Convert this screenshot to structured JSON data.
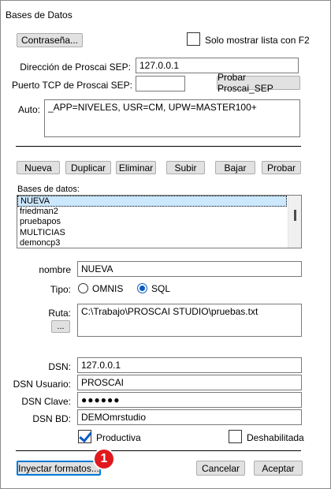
{
  "window": {
    "title": "Bases de Datos"
  },
  "top": {
    "password_button": "Contraseña...",
    "only_list_checkbox": {
      "label": "Solo mostrar lista con F2",
      "checked": false
    }
  },
  "connection": {
    "address_label": "Dirección de Proscai SEP:",
    "address_value": "127.0.0.1",
    "port_label": "Puerto TCP de Proscai SEP:",
    "port_value": "",
    "test_button": "Probar Proscai_SEP",
    "auto_label": "Auto:",
    "auto_value": "_APP=NIVELES, USR=CM, UPW=MASTER100+"
  },
  "actions": {
    "new": "Nueva",
    "duplicate": "Duplicar",
    "delete": "Eliminar",
    "up": "Subir",
    "down": "Bajar",
    "test": "Probar"
  },
  "databases": {
    "label": "Bases de datos:",
    "items": [
      "NUEVA",
      "friedman2",
      "pruebapos",
      "MULTICIAS",
      "demoncp3"
    ],
    "selected_index": 0
  },
  "details": {
    "name_label": "nombre",
    "name_value": "NUEVA",
    "type_label": "Tipo:",
    "type_options": [
      "OMNIS",
      "SQL"
    ],
    "type_selected": "SQL",
    "path_label": "Ruta:",
    "path_browse": "...",
    "path_value": "C:\\Trabajo\\PROSCAI STUDIO\\pruebas.txt",
    "dsn_label": "DSN:",
    "dsn_value": "127.0.0.1",
    "dsn_user_label": "DSN Usuario:",
    "dsn_user_value": "PROSCAI",
    "dsn_password_label": "DSN Clave:",
    "dsn_password_value": "●●●●●●",
    "dsn_db_label": "DSN BD:",
    "dsn_db_value": "DEMOmrstudio",
    "productive": {
      "label": "Productiva",
      "checked": true
    },
    "disabled": {
      "label": "Deshabilitada",
      "checked": false
    }
  },
  "footer": {
    "inject_button": "Inyectar formatos...",
    "cancel_button": "Cancelar",
    "accept_button": "Aceptar",
    "badge": "1"
  },
  "colors": {
    "accent": "#0a5bc4",
    "selection": "#cce8ff",
    "badge": "#e0191f"
  }
}
